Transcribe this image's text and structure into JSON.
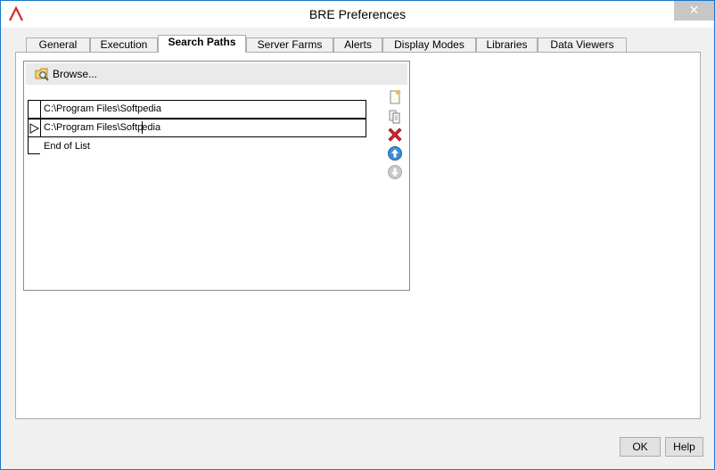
{
  "window": {
    "title": "BRE Preferences",
    "close_label": "✕"
  },
  "tabs": [
    {
      "label": "General",
      "active": false
    },
    {
      "label": "Execution",
      "active": false
    },
    {
      "label": "Search Paths",
      "active": true
    },
    {
      "label": "Server Farms",
      "active": false
    },
    {
      "label": "Alerts",
      "active": false
    },
    {
      "label": "Display Modes",
      "active": false
    },
    {
      "label": "Libraries",
      "active": false
    },
    {
      "label": "Data Viewers",
      "active": false
    }
  ],
  "search_paths": {
    "browse_label": "Browse...",
    "paths": [
      {
        "value": "C:\\Program Files\\Softpedia",
        "current": false
      },
      {
        "value_before_caret": "C:\\Program Files\\Softp",
        "value_after_caret": "edia",
        "current": true
      }
    ],
    "end_label": "End of List",
    "tools": [
      "new-item-icon",
      "copy-icon",
      "delete-icon",
      "move-up-icon",
      "move-down-icon"
    ]
  },
  "buttons": {
    "ok": "OK",
    "help": "Help"
  },
  "colors": {
    "accent": "#1979ca",
    "delete": "#d9262c",
    "arrow_blue": "#3b8fd6",
    "disabled": "#b9b9b9"
  }
}
